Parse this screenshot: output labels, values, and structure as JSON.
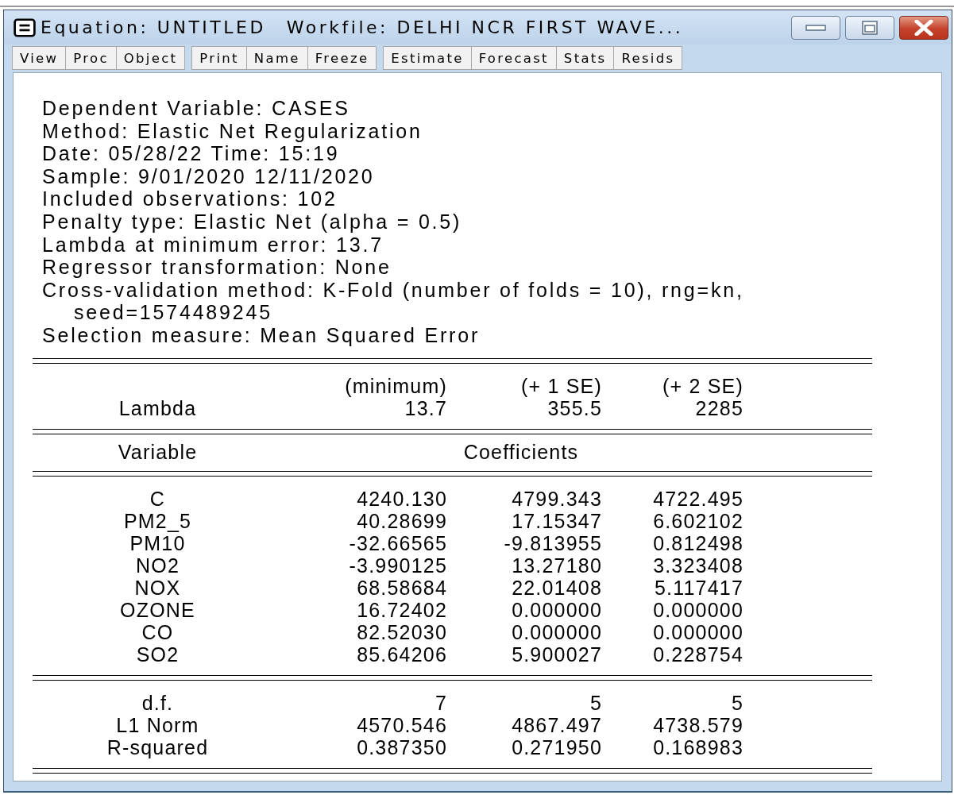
{
  "window": {
    "title_parts": [
      "Equation: UNTITLED",
      "Workfile: DELHI NCR FIRST WAVE..."
    ]
  },
  "toolbar": [
    [
      "View",
      "Proc",
      "Object"
    ],
    [
      "Print",
      "Name",
      "Freeze"
    ],
    [
      "Estimate",
      "Forecast",
      "Stats",
      "Resids"
    ]
  ],
  "header_lines": [
    {
      "kind": "line",
      "text": "Dependent Variable: CASES"
    },
    {
      "kind": "line",
      "text": "Method: Elastic Net Regularization"
    },
    {
      "kind": "line",
      "text": "Date: 05/28/22   Time: 15:19"
    },
    {
      "kind": "line",
      "text": "Sample: 9/01/2020 12/11/2020"
    },
    {
      "kind": "line",
      "text": "Included observations: 102"
    },
    {
      "kind": "line",
      "text": "Penalty type: Elastic Net (alpha = 0.5)"
    },
    {
      "kind": "line",
      "text": "Lambda at minimum error: 13.7"
    },
    {
      "kind": "line",
      "text": "Regressor transformation: None"
    },
    {
      "kind": "line",
      "text": "Cross-validation method: K-Fold (number of folds = 10), rng=kn,"
    },
    {
      "kind": "continuation",
      "text": "seed=1574489245"
    },
    {
      "kind": "line",
      "text": "Selection measure: Mean Squared Error"
    }
  ],
  "lambda_block": {
    "column_headers": [
      "(minimum)",
      "(+ 1 SE)",
      "(+ 2 SE)"
    ],
    "label": "Lambda",
    "values": [
      "13.7",
      "355.5",
      "2285"
    ]
  },
  "coefficient_heading": {
    "variable": "Variable",
    "coefficients": "Coefficients"
  },
  "coefficient_rows": [
    {
      "variable": "C",
      "values": [
        "4240.130",
        "4799.343",
        "4722.495"
      ]
    },
    {
      "variable": "PM2_5",
      "values": [
        "40.28699",
        "17.15347",
        "6.602102"
      ]
    },
    {
      "variable": "PM10",
      "values": [
        "-32.66565",
        "-9.813955",
        "0.812498"
      ]
    },
    {
      "variable": "NO2",
      "values": [
        "-3.990125",
        "13.27180",
        "3.323408"
      ]
    },
    {
      "variable": "NOX",
      "values": [
        "68.58684",
        "22.01408",
        "5.117417"
      ]
    },
    {
      "variable": "OZONE",
      "values": [
        "16.72402",
        "0.000000",
        "0.000000"
      ]
    },
    {
      "variable": "CO",
      "values": [
        "82.52030",
        "0.000000",
        "0.000000"
      ]
    },
    {
      "variable": "SO2",
      "values": [
        "85.64206",
        "5.900027",
        "0.228754"
      ]
    }
  ],
  "summary_rows": [
    {
      "label": "d.f.",
      "values": [
        "7",
        "5",
        "5"
      ]
    },
    {
      "label": "L1 Norm",
      "values": [
        "4570.546",
        "4867.497",
        "4738.579"
      ]
    },
    {
      "label": "R-squared",
      "values": [
        "0.387350",
        "0.271950",
        "0.168983"
      ]
    }
  ]
}
